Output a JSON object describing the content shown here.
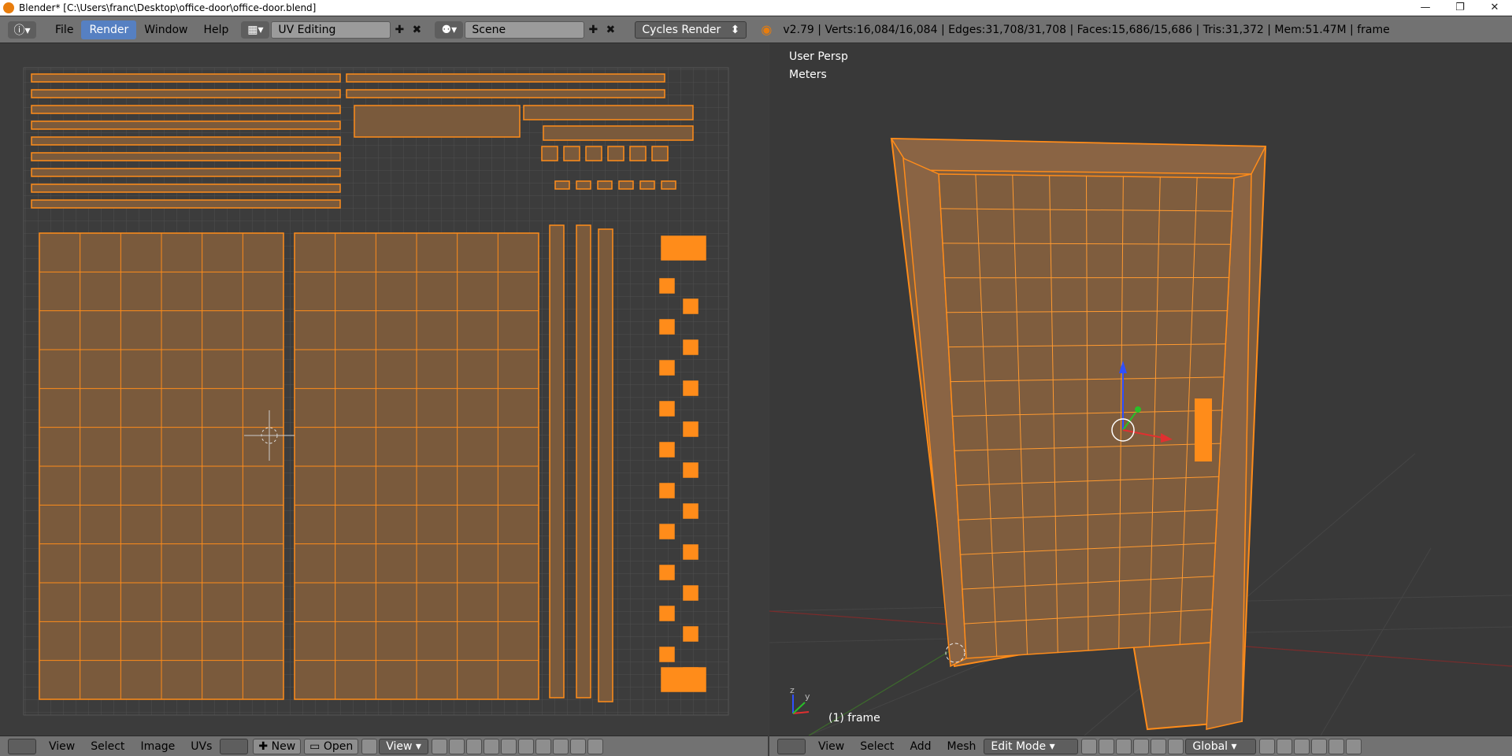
{
  "window": {
    "title": "Blender* [C:\\Users\\franc\\Desktop\\office-door\\office-door.blend]",
    "controls": [
      "minimize",
      "restore",
      "close"
    ]
  },
  "topbar": {
    "menus": [
      "File",
      "Render",
      "Window",
      "Help"
    ],
    "active_menu": "Render",
    "screen_layout": "UV Editing",
    "scene": "Scene",
    "render_engine": "Cycles Render",
    "stats": "v2.79 | Verts:16,084/16,084 | Edges:31,708/31,708 | Faces:15,686/15,686 | Tris:31,372 | Mem:51.47M | frame"
  },
  "uv_editor": {
    "footer": {
      "menus": [
        "View",
        "Select",
        "Image",
        "UVs"
      ],
      "new_label": "New",
      "open_label": "Open",
      "view_dropdown": "View"
    }
  },
  "viewport": {
    "view_name": "User Persp",
    "units": "Meters",
    "object_label": "(1) frame",
    "footer": {
      "menus": [
        "View",
        "Select",
        "Add",
        "Mesh"
      ],
      "mode": "Edit Mode",
      "orientation": "Global"
    }
  },
  "colors": {
    "selected": "#ff8c1a",
    "uv_fill": "#7a5a3c",
    "active_menu": "#5680c2"
  }
}
